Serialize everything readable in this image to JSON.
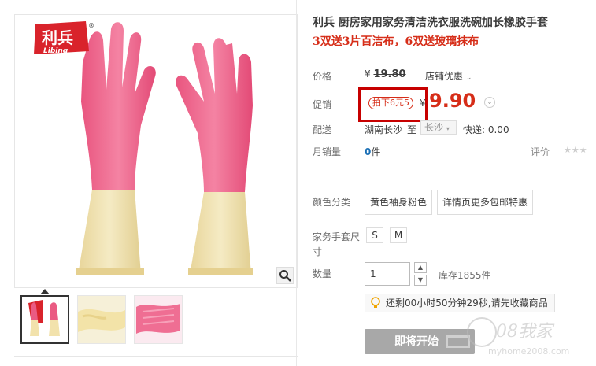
{
  "product": {
    "title": "利兵 厨房家用家务清洁洗衣服洗碗加长橡胶手套",
    "subtitle": "3双送3片百洁布，6双送玻璃抹布",
    "brand_logo": {
      "text": "利兵",
      "sub": "Libing",
      "reg": "®"
    }
  },
  "price": {
    "label": "价格",
    "currency": "¥",
    "original": "19.80",
    "shop_promo": "店铺优惠",
    "promo_label": "促销",
    "promo_tag": "拍下6元5",
    "promo_currency": "¥",
    "promo_price": "9.90"
  },
  "shipping": {
    "label": "配送",
    "from": "湖南长沙",
    "to_word": "至",
    "to_city": "长沙",
    "fee": "快递: 0.00"
  },
  "sales": {
    "label": "月销量",
    "count": "0",
    "unit": "件",
    "rating_label": "评价",
    "stars": "★★★"
  },
  "options": {
    "color_label": "颜色分类",
    "colors": [
      "黄色袖身粉色",
      "详情页更多包邮特惠"
    ],
    "size_label": "家务手套尺",
    "size_label2": "寸",
    "sizes": [
      "S",
      "M"
    ]
  },
  "quantity": {
    "label": "数量",
    "value": "1",
    "stock": "库存1855件"
  },
  "countdown": {
    "text": "还剩00小时50分钟29秒,请先收藏商品"
  },
  "buy": {
    "label": "即将开始"
  },
  "watermark": {
    "text": "08我家",
    "url": "myhome2008.com"
  },
  "colors": {
    "accent": "#d62d18",
    "highlight": "#c70000",
    "link": "#1a6fb5",
    "disabled": "#a8a8a8"
  },
  "icons": [
    "zoom-icon",
    "chevron-down-icon",
    "bulb-icon",
    "stepper-up-icon",
    "stepper-down-icon"
  ]
}
